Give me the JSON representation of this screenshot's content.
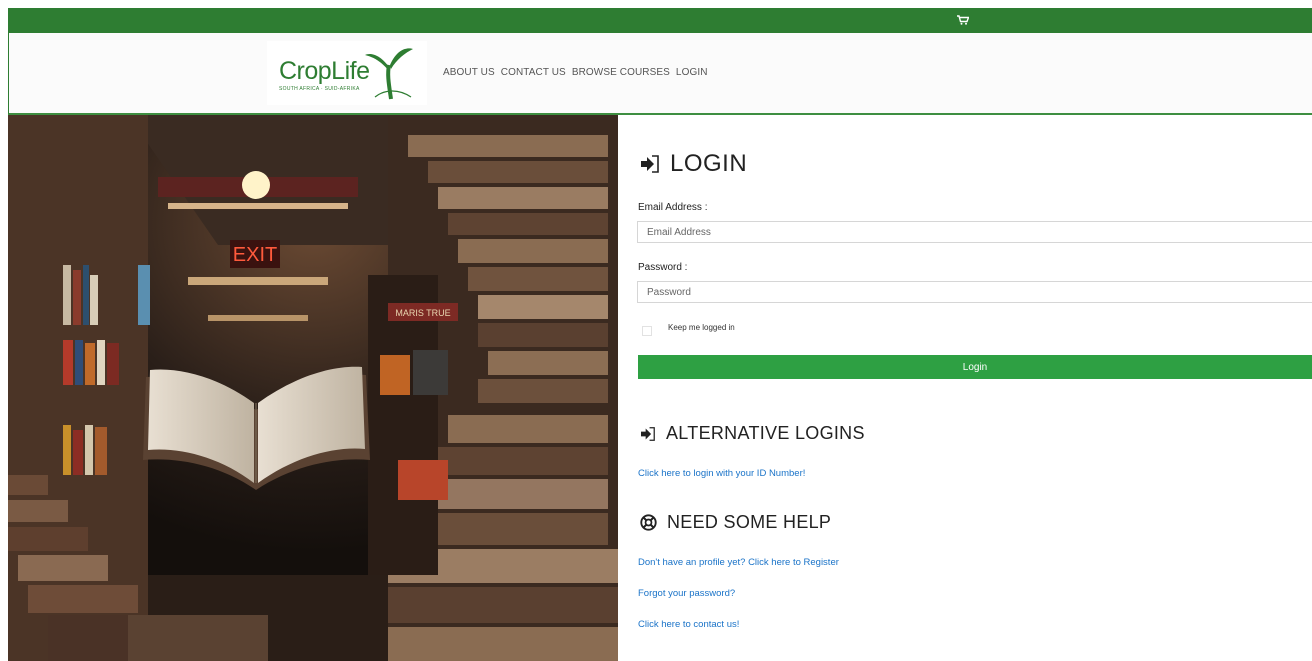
{
  "colors": {
    "brand_green": "#2e7d32",
    "button_green": "#2ea043",
    "link_blue": "#1a73c8"
  },
  "topbar": {
    "cart_icon": "cart-icon"
  },
  "logo": {
    "text": "CropLife",
    "subtext": "SOUTH AFRICA · SUID-AFRIKA"
  },
  "nav": {
    "items": [
      {
        "label": "ABOUT US"
      },
      {
        "label": "CONTACT US"
      },
      {
        "label": "BROWSE COURSES"
      },
      {
        "label": "LOGIN"
      }
    ]
  },
  "hero": {
    "image": "library-with-floating-open-book",
    "sign": "EXIT",
    "books_sign": "MARIS TRUE"
  },
  "login": {
    "heading": "LOGIN",
    "heading_icon": "sign-in-icon",
    "email_label": "Email Address :",
    "email_placeholder": "Email Address",
    "password_label": "Password :",
    "password_placeholder": "Password",
    "remember_label": "Keep me logged in",
    "button_label": "Login"
  },
  "alternative": {
    "heading": "ALTERNATIVE LOGINS",
    "heading_icon": "sign-in-icon",
    "id_link": "Click here to login with your ID Number!"
  },
  "help": {
    "heading": "NEED SOME HELP",
    "heading_icon": "life-ring-icon",
    "register_link": "Don't have an profile yet? Click here to Register",
    "forgot_link": "Forgot your password?",
    "contact_link": "Click here to contact us!"
  }
}
